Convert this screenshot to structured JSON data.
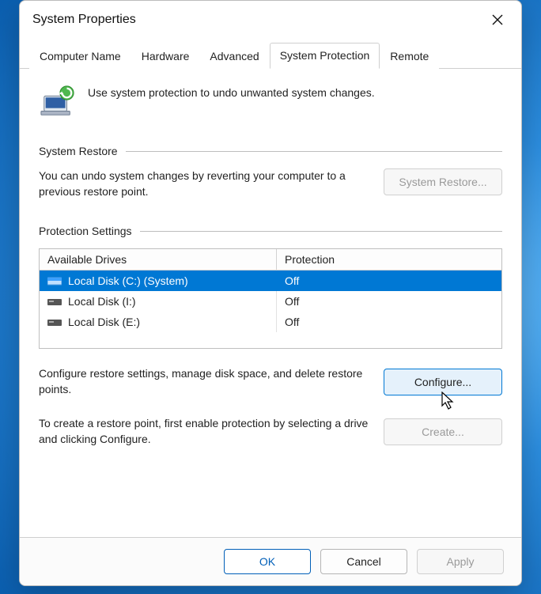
{
  "window": {
    "title": "System Properties"
  },
  "tabs": [
    {
      "label": "Computer Name",
      "active": false
    },
    {
      "label": "Hardware",
      "active": false
    },
    {
      "label": "Advanced",
      "active": false
    },
    {
      "label": "System Protection",
      "active": true
    },
    {
      "label": "Remote",
      "active": false
    }
  ],
  "intro": "Use system protection to undo unwanted system changes.",
  "groups": {
    "restore": {
      "title": "System Restore",
      "text": "You can undo system changes by reverting your computer to a previous restore point.",
      "button": "System Restore...",
      "button_enabled": false
    },
    "protection": {
      "title": "Protection Settings",
      "columns": {
        "drive": "Available Drives",
        "protection": "Protection"
      },
      "drives": [
        {
          "name": "Local Disk (C:) (System)",
          "protection": "Off",
          "selected": true,
          "icon": "drive-system-icon"
        },
        {
          "name": "Local Disk (I:)",
          "protection": "Off",
          "selected": false,
          "icon": "drive-icon"
        },
        {
          "name": "Local Disk (E:)",
          "protection": "Off",
          "selected": false,
          "icon": "drive-icon"
        }
      ],
      "configure_text": "Configure restore settings, manage disk space, and delete restore points.",
      "configure_button": "Configure...",
      "create_text": "To create a restore point, first enable protection by selecting a drive and clicking Configure.",
      "create_button": "Create...",
      "create_enabled": false
    }
  },
  "footer": {
    "ok": "OK",
    "cancel": "Cancel",
    "apply": "Apply",
    "apply_enabled": false
  }
}
